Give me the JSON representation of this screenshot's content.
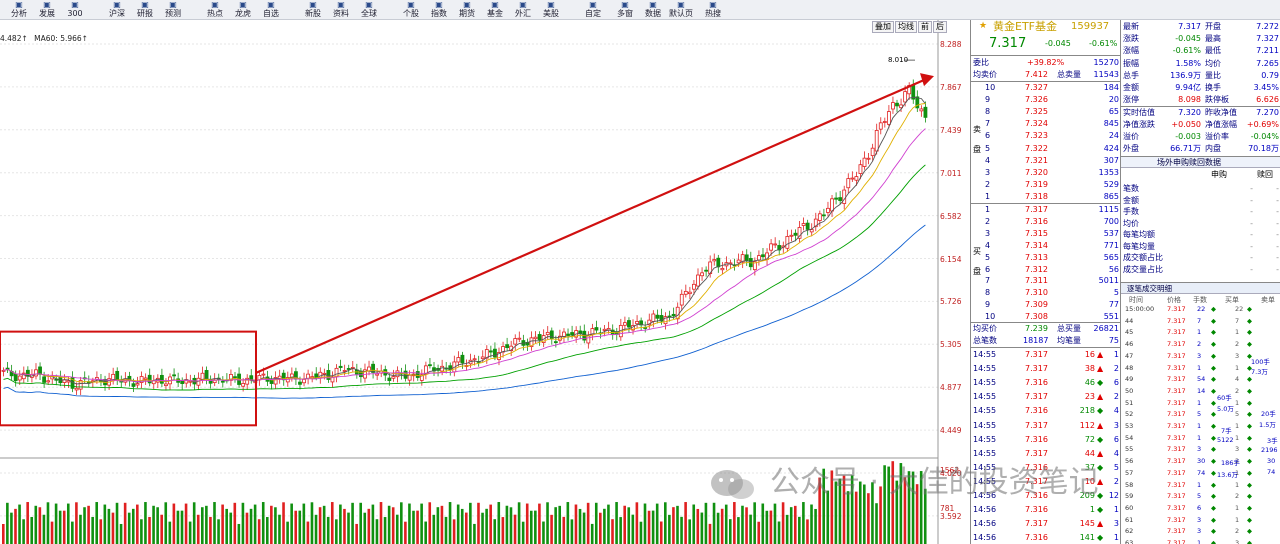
{
  "toolbar": {
    "items": [
      {
        "label": "分析",
        "icon": "chart-icon"
      },
      {
        "label": "发展",
        "icon": "growth-icon"
      },
      {
        "label": "300",
        "icon": "index-icon"
      },
      {
        "label": "沪深",
        "icon": "market-icon"
      },
      {
        "label": "研报",
        "icon": "report-icon"
      },
      {
        "label": "预测",
        "icon": "forecast-icon"
      },
      {
        "label": "热点",
        "icon": "fire-icon"
      },
      {
        "label": "龙虎",
        "icon": "dragon-icon"
      },
      {
        "label": "自选",
        "icon": "star-icon"
      },
      {
        "label": "新股",
        "icon": "new-icon"
      },
      {
        "label": "资料",
        "icon": "doc-icon"
      },
      {
        "label": "全球",
        "icon": "globe-icon"
      },
      {
        "label": "个股",
        "icon": "stock-icon"
      },
      {
        "label": "指数",
        "icon": "index-icon"
      },
      {
        "label": "期货",
        "icon": "futures-icon"
      },
      {
        "label": "基金",
        "icon": "fund-icon"
      },
      {
        "label": "外汇",
        "icon": "fx-icon"
      },
      {
        "label": "美股",
        "icon": "us-icon"
      },
      {
        "label": "自定",
        "icon": "custom-icon"
      },
      {
        "label": "多窗",
        "icon": "window-icon"
      },
      {
        "label": "数据",
        "icon": "data-icon"
      },
      {
        "label": "默认页",
        "icon": "home-icon"
      },
      {
        "label": "热搜",
        "icon": "search-icon"
      }
    ]
  },
  "ma_header": [
    "4.482↑",
    "MA60: 5.966↑"
  ],
  "period_buttons": [
    "叠加",
    "均线",
    "前",
    "后"
  ],
  "price_axis": [
    "8.288",
    "7.867",
    "7.439",
    "7.011",
    "6.582",
    "6.154",
    "5.726",
    "5.305",
    "4.877",
    "4.449",
    "4.020",
    "3.592",
    "3.164"
  ],
  "vol_axis": [
    "1562",
    "781"
  ],
  "peak_label": "8.010",
  "chart_data": {
    "type": "candlestick",
    "ylim": [
      3.164,
      8.288
    ],
    "close_path": [
      3.9,
      3.86,
      3.88,
      3.8,
      3.75,
      3.78,
      3.82,
      3.8,
      3.78,
      3.81,
      3.79,
      3.8,
      3.82,
      3.81,
      3.8,
      3.82,
      3.83,
      3.82,
      3.84,
      3.88,
      3.95,
      3.92,
      3.9,
      3.85,
      3.87,
      3.95,
      3.98,
      4.05,
      4.1,
      4.2,
      4.3,
      4.35,
      4.38,
      4.4,
      4.42,
      4.45,
      4.48,
      4.55,
      4.6,
      4.65,
      4.95,
      5.3,
      5.35,
      5.38,
      5.4,
      5.55,
      5.7,
      5.85,
      6.0,
      6.3,
      6.55,
      7.0,
      7.45,
      7.65,
      7.32
    ],
    "highlight_box": {
      "from_value": 3.2,
      "to_value": 4.45
    },
    "trend_arrow": {
      "from": 3.9,
      "to": 7.86
    }
  },
  "quote": {
    "title_prefix": "★",
    "name": "黄金ETF基金",
    "code": "159937",
    "price": "7.317",
    "change": "-0.045",
    "pct": "-0.61%",
    "wei_bi_label": "委比",
    "wei_bi": "+39.82%",
    "wei_cha": "15270",
    "ask_avg_label": "均卖价",
    "ask_avg": "7.412",
    "ask_total_label": "总卖量",
    "ask_total": "11543",
    "sell_label": "卖盘",
    "buy_label": "买盘",
    "asks": [
      [
        "10",
        "7.327",
        "184"
      ],
      [
        "9",
        "7.326",
        "20"
      ],
      [
        "8",
        "7.325",
        "65"
      ],
      [
        "7",
        "7.324",
        "845"
      ],
      [
        "6",
        "7.323",
        "24"
      ],
      [
        "5",
        "7.322",
        "424"
      ],
      [
        "4",
        "7.321",
        "307"
      ],
      [
        "3",
        "7.320",
        "1353"
      ],
      [
        "2",
        "7.319",
        "529"
      ],
      [
        "1",
        "7.318",
        "865"
      ]
    ],
    "bids": [
      [
        "1",
        "7.317",
        "1115"
      ],
      [
        "2",
        "7.316",
        "700"
      ],
      [
        "3",
        "7.315",
        "537"
      ],
      [
        "4",
        "7.314",
        "771"
      ],
      [
        "5",
        "7.313",
        "565"
      ],
      [
        "6",
        "7.312",
        "56"
      ],
      [
        "7",
        "7.311",
        "5011"
      ],
      [
        "8",
        "7.310",
        "5"
      ],
      [
        "9",
        "7.309",
        "77"
      ],
      [
        "10",
        "7.308",
        "551"
      ]
    ],
    "bid_avg_label": "均买价",
    "bid_avg": "7.239",
    "bid_total_label": "总买量",
    "bid_total": "26821",
    "deal_total_label": "总笔数",
    "deal_total": "18187",
    "avg_lot_label": "均笔量",
    "avg_lot": "75",
    "trades": [
      [
        "14:55",
        "7.317",
        "16",
        "1",
        "down"
      ],
      [
        "14:55",
        "7.317",
        "38",
        "2",
        "down"
      ],
      [
        "14:55",
        "7.316",
        "46",
        "6",
        "up"
      ],
      [
        "14:55",
        "7.317",
        "23",
        "2",
        "down"
      ],
      [
        "14:55",
        "7.316",
        "218",
        "4",
        "up"
      ],
      [
        "14:55",
        "7.317",
        "112",
        "3",
        "down"
      ],
      [
        "14:55",
        "7.316",
        "72",
        "6",
        "up"
      ],
      [
        "14:55",
        "7.317",
        "44",
        "4",
        "down"
      ],
      [
        "14:55",
        "7.316",
        "37",
        "5",
        "up"
      ],
      [
        "14:55",
        "7.317",
        "10",
        "2",
        "down"
      ],
      [
        "14:56",
        "7.316",
        "209",
        "12",
        "up"
      ],
      [
        "14:56",
        "7.316",
        "1",
        "1",
        "up"
      ],
      [
        "14:56",
        "7.317",
        "145",
        "3",
        "down"
      ],
      [
        "14:56",
        "7.316",
        "141",
        "1",
        "up"
      ]
    ]
  },
  "fundamentals": {
    "rows": [
      [
        "最新",
        "7.317",
        "开盘",
        "7.272"
      ],
      [
        "涨跌",
        "-0.045",
        "最高",
        "7.327"
      ],
      [
        "涨幅",
        "-0.61%",
        "最低",
        "7.211"
      ],
      [
        "振幅",
        "1.58%",
        "均价",
        "7.265"
      ],
      [
        "总手",
        "136.9万",
        "量比",
        "0.79"
      ],
      [
        "金额",
        "9.94亿",
        "换手",
        "3.45%"
      ],
      [
        "涨停",
        "8.098",
        "跌停板",
        "6.626"
      ],
      [
        "实时估值",
        "7.320",
        "昨收净值",
        "7.270"
      ],
      [
        "净值涨跌",
        "+0.050",
        "净值涨幅",
        "+0.69%"
      ],
      [
        "溢价",
        "-0.003",
        "溢价率",
        "-0.04%"
      ],
      [
        "外盘",
        "66.71万",
        "内盘",
        "70.18万"
      ]
    ],
    "otc_title": "场外申购赎回数据",
    "otc_cols": [
      "申购",
      "赎回"
    ],
    "otc_rows": [
      "笔数",
      "金额",
      "手数",
      "均价",
      "每笔均额",
      "每笔均量",
      "成交额占比",
      "成交量占比"
    ],
    "ticks_title": "逐笔成交明细",
    "ticks_cols": [
      "时间",
      "价格",
      "手数",
      "买单",
      "卖单"
    ],
    "ticks": [
      [
        "15:00:00",
        "7.317",
        "22",
        "22"
      ],
      [
        "44",
        "7.317",
        "7",
        "7"
      ],
      [
        "45",
        "7.317",
        "1",
        "1"
      ],
      [
        "46",
        "7.317",
        "2",
        "2"
      ],
      [
        "47",
        "7.317",
        "3",
        "3"
      ],
      [
        "48",
        "7.317",
        "1",
        "1"
      ],
      [
        "49",
        "7.317",
        "54",
        "4"
      ],
      [
        "50",
        "7.317",
        "14",
        "2"
      ],
      [
        "51",
        "7.317",
        "1",
        "1"
      ],
      [
        "52",
        "7.317",
        "5",
        "5"
      ],
      [
        "53",
        "7.317",
        "1",
        "1"
      ],
      [
        "54",
        "7.317",
        "1",
        "1"
      ],
      [
        "55",
        "7.317",
        "3",
        "3"
      ],
      [
        "56",
        "7.317",
        "30",
        "2"
      ],
      [
        "57",
        "7.317",
        "74",
        "1"
      ],
      [
        "58",
        "7.317",
        "1",
        "1"
      ],
      [
        "59",
        "7.317",
        "5",
        "2"
      ],
      [
        "60",
        "7.317",
        "6",
        "1"
      ],
      [
        "61",
        "7.317",
        "3",
        "1"
      ],
      [
        "62",
        "7.317",
        "3",
        "2"
      ],
      [
        "63",
        "7.317",
        "1",
        "3"
      ]
    ],
    "tick_side_notes": [
      "100手",
      "7.3万",
      "60手",
      "5.0万",
      "7手",
      "5122",
      "186手",
      "13.6万",
      "20手",
      "1.5万",
      "3手",
      "2196",
      "30",
      "74"
    ]
  },
  "watermark": "公众号 · 大佳的投资笔记"
}
